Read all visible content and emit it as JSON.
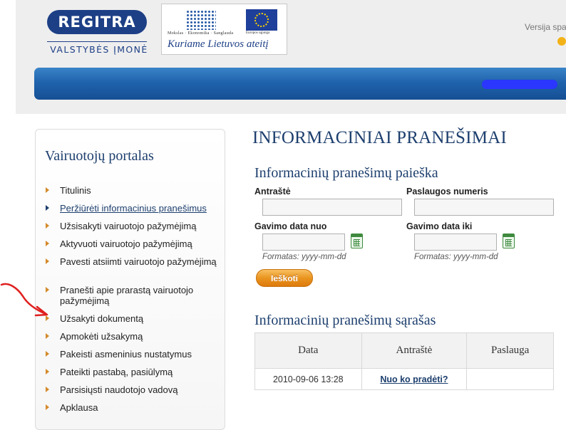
{
  "header": {
    "logo": {
      "text": "REGITRA",
      "subtitle": "VALSTYBĖS ĮMONĖ"
    },
    "eu_banner": {
      "small_left": "Mokslas · Ekonomika · Sanglauda",
      "small_right": "Europos sąjunga",
      "slogan": "Kuriame Lietuvos ateitį"
    },
    "version_text": "Versija spa"
  },
  "sidebar": {
    "title": "Vairuotojų portalas",
    "items": [
      {
        "label": "Titulinis",
        "active": false
      },
      {
        "label": "Peržiūrėti informacinius pranešimus",
        "active": true
      },
      {
        "label": "Užsisakyti vairuotojo pažymėjimą",
        "active": false
      },
      {
        "label": "Aktyvuoti vairuotojo pažymėjimą",
        "active": false
      },
      {
        "label": "Pavesti atsiimti vairuotojo pažymėjimą",
        "active": false
      },
      {
        "label": "Pranešti apie prarastą vairuotojo pažymėjimą",
        "active": false
      },
      {
        "label": "Užsakyti dokumentą",
        "active": false
      },
      {
        "label": "Apmokėti užsakymą",
        "active": false
      },
      {
        "label": "Pakeisti asmeninius nustatymus",
        "active": false
      },
      {
        "label": "Pateikti pastabą, pasiūlymą",
        "active": false
      },
      {
        "label": "Parsisiųsti naudotojo vadovą",
        "active": false
      },
      {
        "label": "Apklausa",
        "active": false
      }
    ]
  },
  "main": {
    "page_title": "INFORMACINIAI PRANEŠIMAI",
    "search": {
      "title": "Informacinių pranešimų paieška",
      "fields": {
        "title_label": "Antraštė",
        "title_value": "",
        "service_label": "Paslaugos numeris",
        "service_value": "",
        "date_from_label": "Gavimo data nuo",
        "date_from_value": "",
        "date_to_label": "Gavimo data iki",
        "date_to_value": ""
      },
      "format_hint": "Formatas: yyyy-mm-dd",
      "button_label": "Ieškoti"
    },
    "list": {
      "title": "Informacinių pranešimų sąrašas",
      "columns": [
        "Data",
        "Antraštė",
        "Paslauga"
      ],
      "rows": [
        {
          "date": "2010-09-06 13:28",
          "title": "Nuo ko pradėti?",
          "service": ""
        }
      ]
    }
  },
  "colors": {
    "brand_blue": "#1d3f86",
    "title_blue": "#1d3f6e",
    "nav_bar": "#1f63ad",
    "button_orange": "#ea9420",
    "menu_bullet": "#d48a2c",
    "annotation_arrow": "#e01f1f"
  },
  "icons": {
    "calendar": "calendar-icon",
    "menu_bullet": "triangle-right-icon"
  }
}
